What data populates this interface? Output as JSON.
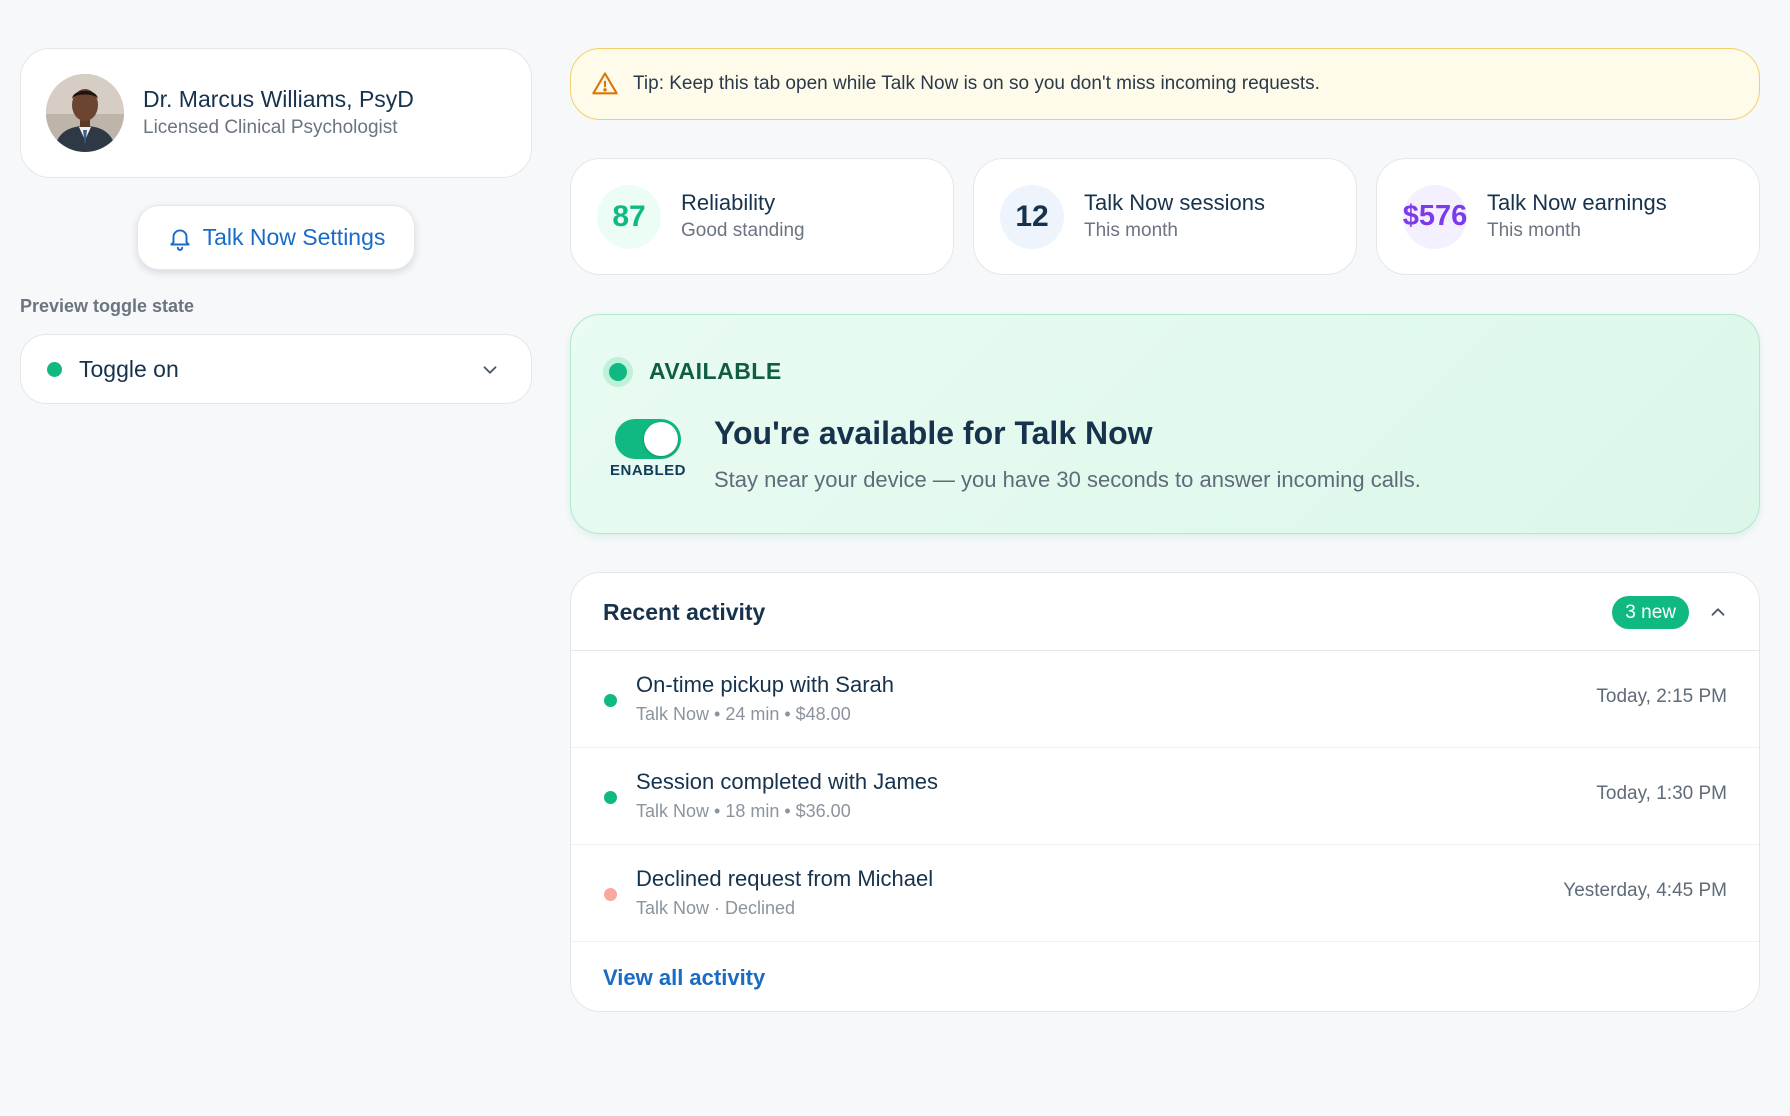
{
  "profile": {
    "name": "Dr. Marcus Williams, PsyD",
    "title": "Licensed Clinical Psychologist",
    "avatar_icon": "avatar-photo"
  },
  "settings_button": {
    "label": "Talk Now Settings",
    "icon": "bell-icon"
  },
  "preview": {
    "label": "Preview toggle state",
    "selected": "Toggle on",
    "indicator_color": "#10b981"
  },
  "tip": {
    "text": "Tip: Keep this tab open while Talk Now is on so you don't miss incoming requests.",
    "icon": "warning-icon"
  },
  "stats": [
    {
      "value": "87",
      "title": "Reliability",
      "subtitle": "Good standing",
      "color": "#10b981",
      "bg": "#ecfdf5"
    },
    {
      "value": "12",
      "title": "Talk Now sessions",
      "subtitle": "This month",
      "color": "#17324d",
      "bg": "#eef4fb"
    },
    {
      "value": "$576",
      "title": "Talk Now earnings",
      "subtitle": "This month",
      "color": "#7c3aed",
      "bg": "#f5f0ff"
    }
  ],
  "availability": {
    "status": "AVAILABLE",
    "toggle_label": "ENABLED",
    "toggle_on": true,
    "title": "You're available for Talk Now",
    "description": "Stay near your device — you have 30 seconds to answer incoming calls."
  },
  "activity": {
    "title": "Recent activity",
    "badge": "3 new",
    "items": [
      {
        "title": "On-time pickup with Sarah",
        "subtitle": "Talk Now • 24 min • $48.00",
        "time": "Today, 2:15 PM",
        "dot_color": "#10b981"
      },
      {
        "title": "Session completed with James",
        "subtitle": "Talk Now • 18 min • $36.00",
        "time": "Today, 1:30 PM",
        "dot_color": "#10b981"
      },
      {
        "title": "Declined request from Michael",
        "subtitle": "Talk Now · Declined",
        "time": "Yesterday, 4:45 PM",
        "dot_color": "#f9a8a0"
      }
    ],
    "view_all": "View all activity"
  }
}
